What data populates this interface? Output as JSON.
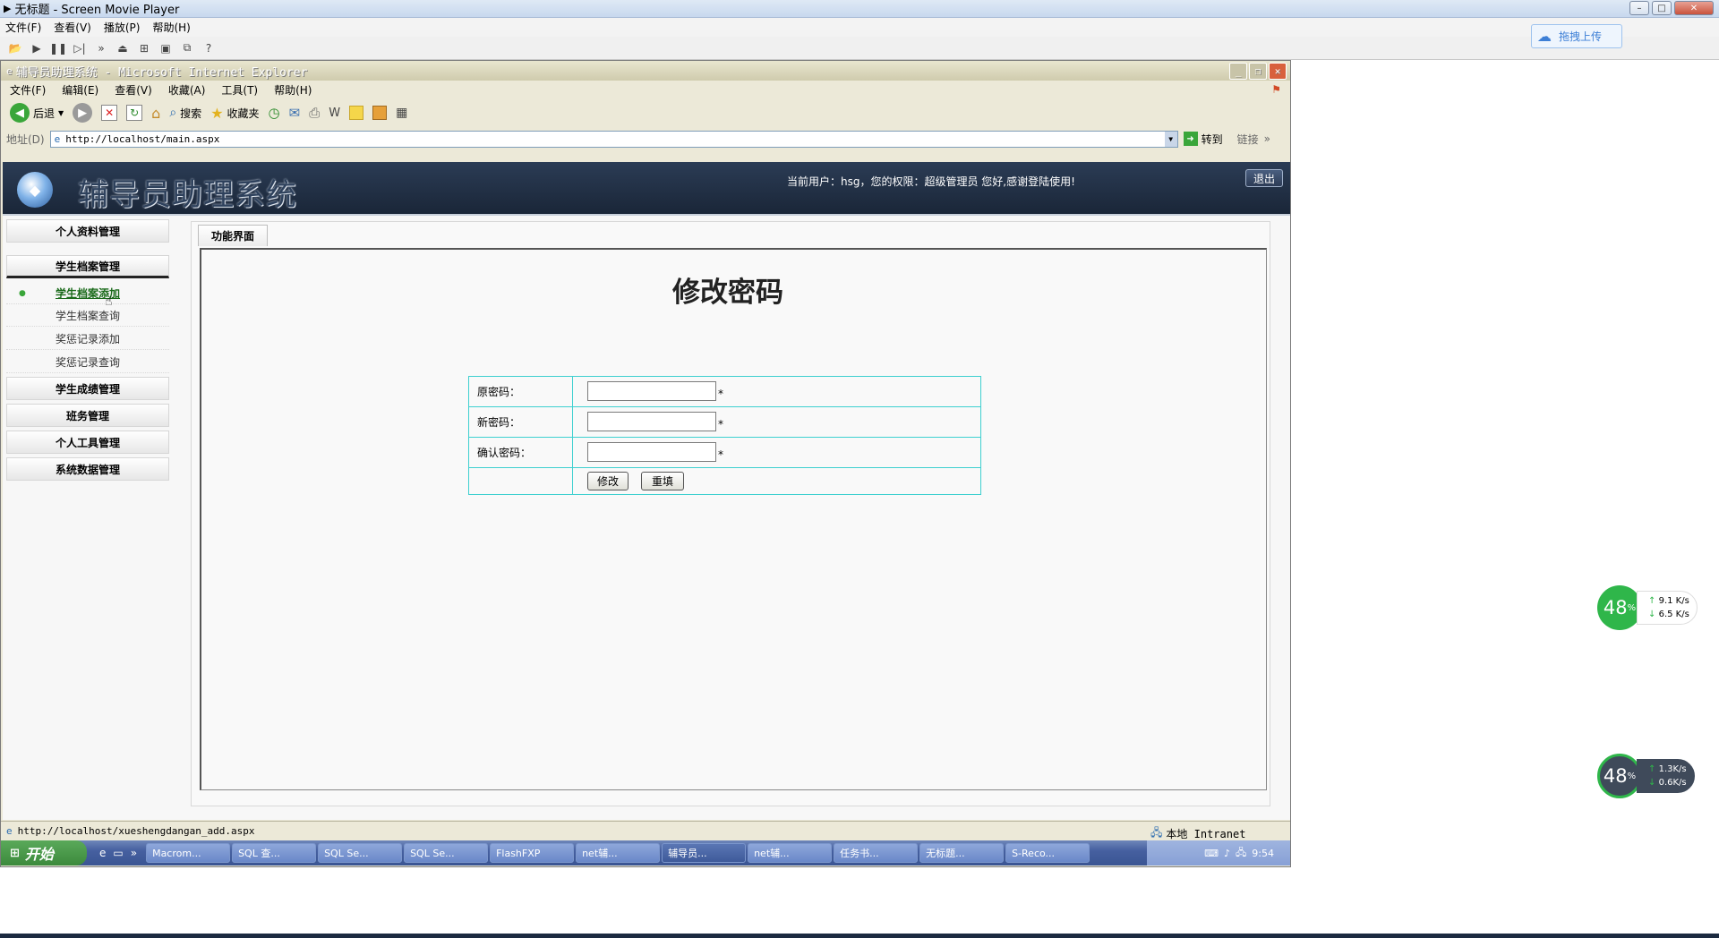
{
  "player": {
    "title": "无标题 - Screen Movie Player",
    "menu": [
      "文件(F)",
      "查看(V)",
      "播放(P)",
      "帮助(H)"
    ],
    "upload_label": "拖拽上传"
  },
  "ie": {
    "title": "辅导员助理系统 - Microsoft Internet Explorer",
    "menu": [
      "文件(F)",
      "编辑(E)",
      "查看(V)",
      "收藏(A)",
      "工具(T)",
      "帮助(H)"
    ],
    "toolbar": {
      "back": "后退",
      "search": "搜索",
      "favorites": "收藏夹"
    },
    "address_label": "地址(D)",
    "address_url": "http://localhost/main.aspx",
    "go_label": "转到",
    "links_label": "链接",
    "status_url": "http://localhost/xueshengdangan_add.aspx",
    "zone": "本地 Intranet"
  },
  "app": {
    "system_title": "辅导员助理系统",
    "user_info": "当前用户：hsg，您的权限：超级管理员  您好,感谢登陆使用!",
    "logout_label": "退出",
    "sidebar": {
      "groups": [
        "个人资料管理",
        "学生档案管理",
        "学生成绩管理",
        "班务管理",
        "个人工具管理",
        "系统数据管理"
      ],
      "sub_items": [
        "学生档案添加",
        "学生档案查询",
        "奖惩记录添加",
        "奖惩记录查询"
      ]
    },
    "tab_label": "功能界面",
    "form": {
      "title": "修改密码",
      "old_password_label": "原密码：",
      "new_password_label": "新密码：",
      "confirm_password_label": "确认密码：",
      "required_mark": "*",
      "submit_label": "修改",
      "reset_label": "重填"
    }
  },
  "taskbar": {
    "start_label": "开始",
    "tasks": [
      "Macrom...",
      "SQL 查...",
      "SQL Se...",
      "SQL Se...",
      "FlashFXP",
      "net辅...",
      "辅导员...",
      "net辅...",
      "任务书...",
      "无标题...",
      "S-Reco..."
    ],
    "active_task_index": 6,
    "clock": "9:54"
  },
  "net_meters": [
    {
      "percent": "48",
      "up": "9.1 K/s",
      "down": "6.5 K/s",
      "color": "#2fb64a"
    },
    {
      "percent": "48",
      "up": "1.3K/s",
      "down": "0.6K/s",
      "color": "#3f4a5a"
    }
  ]
}
